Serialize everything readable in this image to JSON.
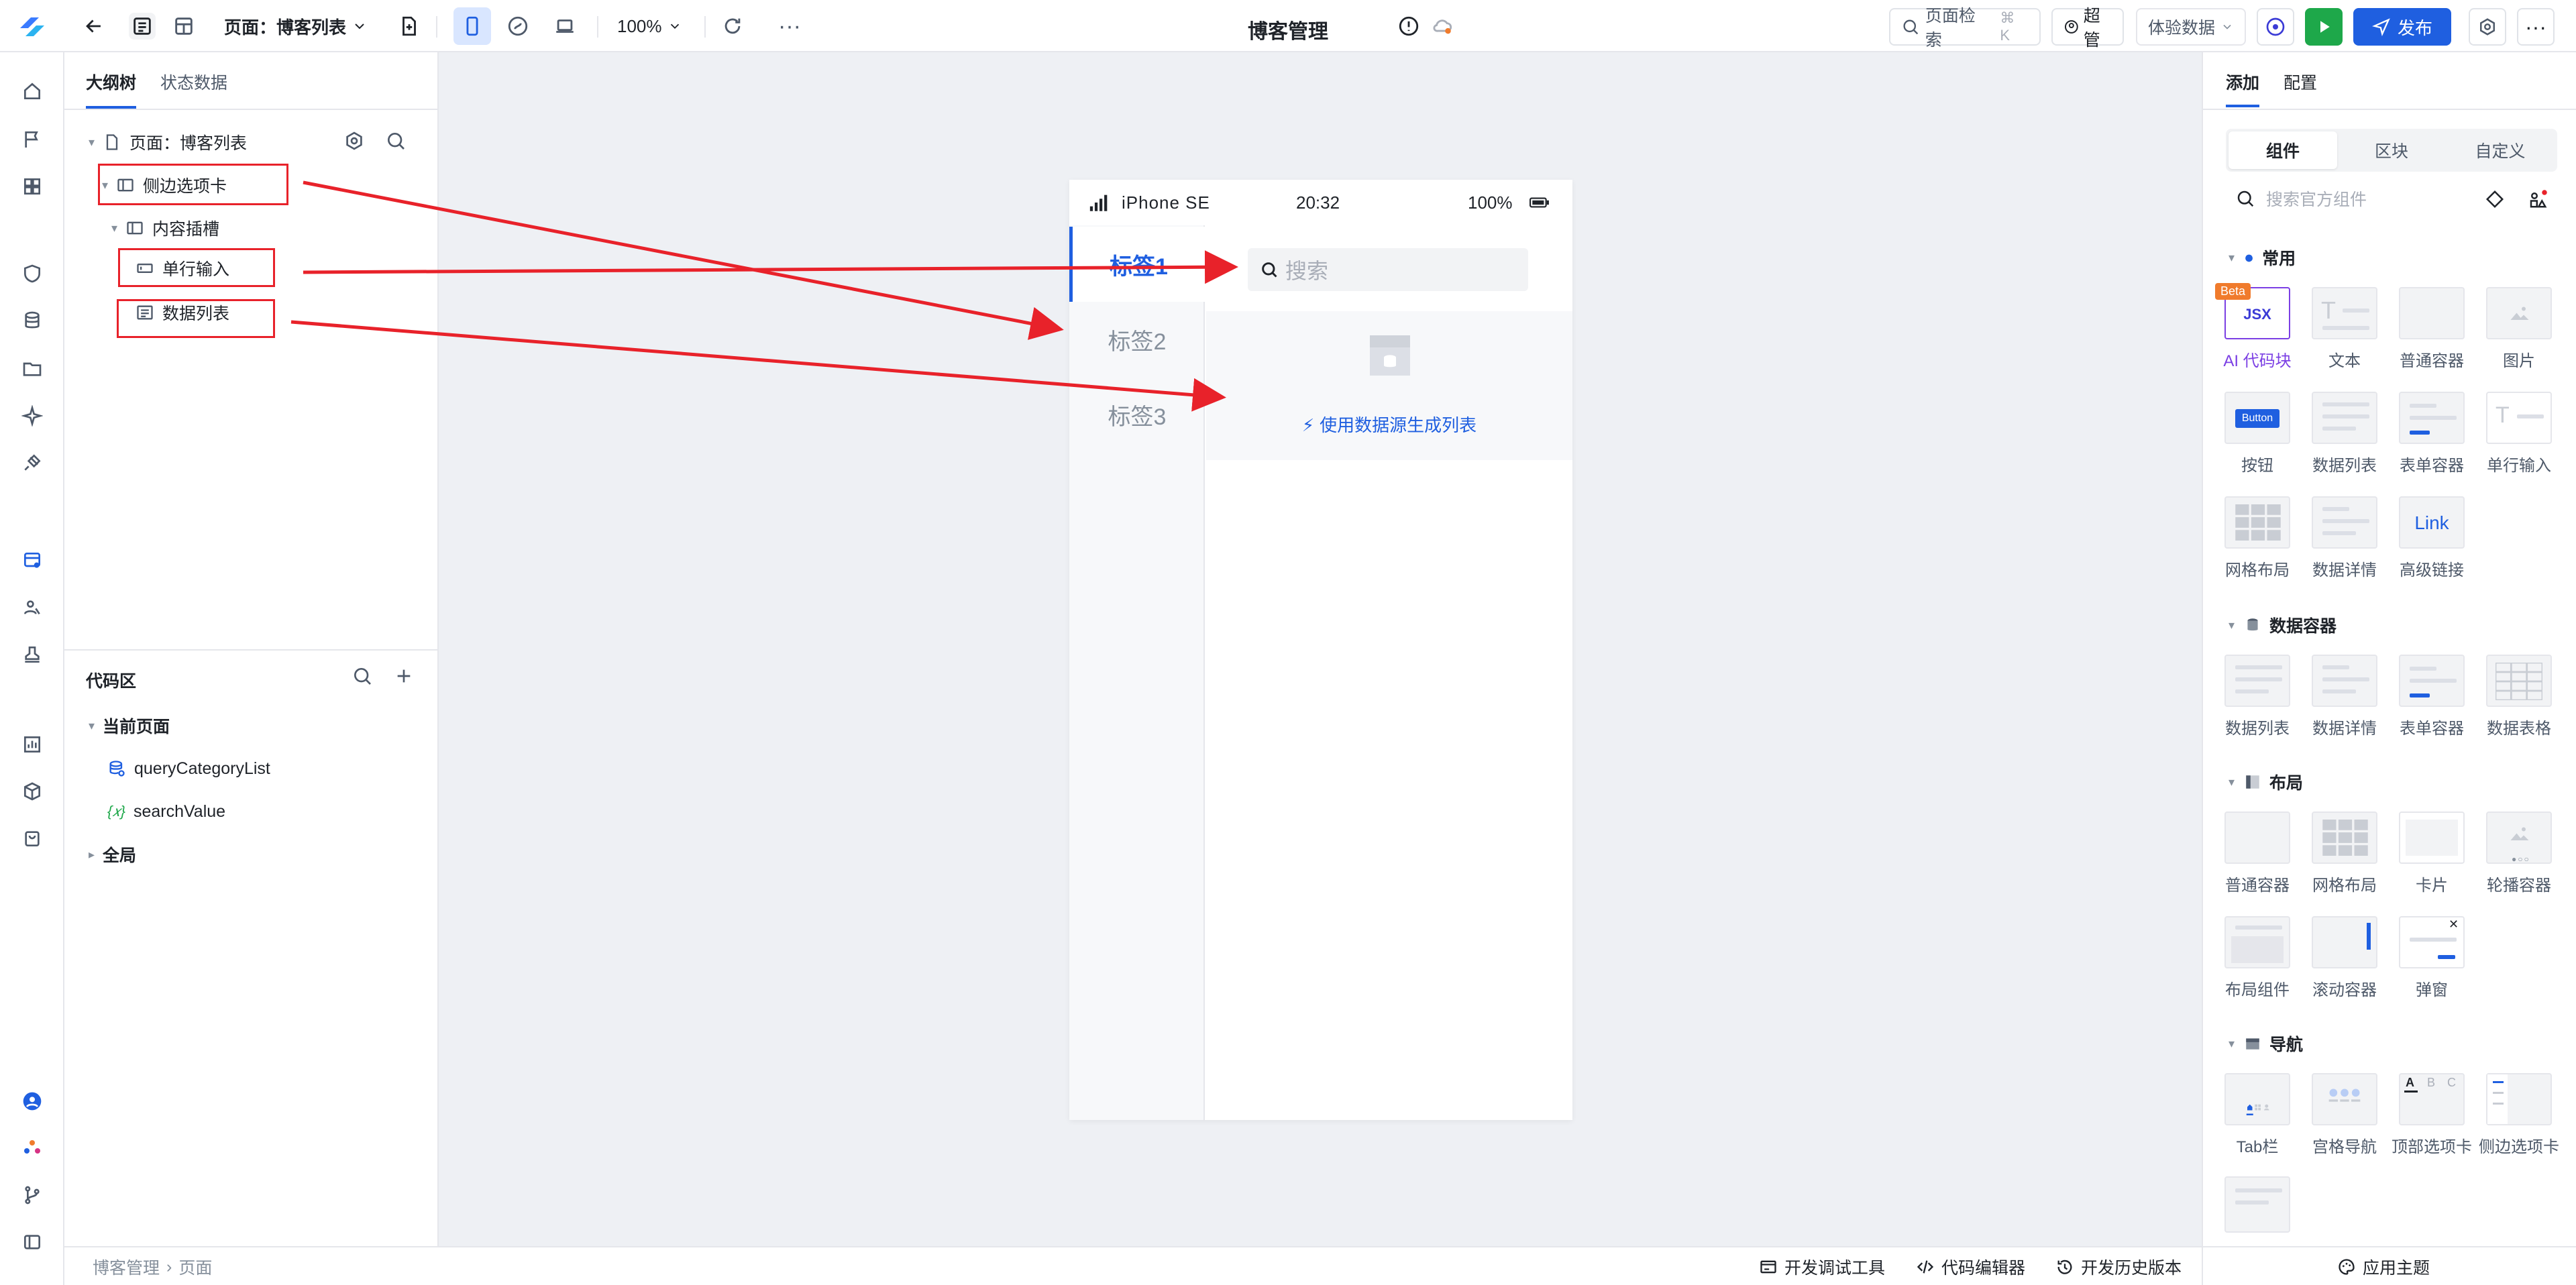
{
  "topbar": {
    "page_label": "页面：博客列表",
    "zoom": "100%",
    "app_title": "博客管理",
    "search_label": "页面检索",
    "search_shortcut": "⌘ K",
    "user_label": "超管",
    "experience_data": "体验数据",
    "publish_label": "发布"
  },
  "outline": {
    "tabs": [
      "大纲树",
      "状态数据"
    ],
    "tree": {
      "page": "页面：博客列表",
      "side_tabs": "侧边选项卡",
      "content_slot": "内容插槽",
      "single_input": "单行输入",
      "data_list": "数据列表"
    },
    "code": {
      "title": "代码区",
      "current_page": "当前页面",
      "items": [
        "queryCategoryList",
        "searchValue"
      ],
      "global": "全局"
    }
  },
  "phone": {
    "device": "iPhone SE",
    "time": "20:32",
    "battery": "100%",
    "tabs": [
      "标签1",
      "标签2",
      "标签3"
    ],
    "search_placeholder": "搜索",
    "gen_list_link": "使用数据源生成列表"
  },
  "right": {
    "tabs": [
      "添加",
      "配置"
    ],
    "segments": [
      "组件",
      "区块",
      "自定义"
    ],
    "search_placeholder": "搜索官方组件",
    "sections": {
      "common": {
        "title": "常用",
        "items": [
          "AI 代码块",
          "文本",
          "普通容器",
          "图片",
          "按钮",
          "数据列表",
          "表单容器",
          "单行输入",
          "网格布局",
          "数据详情",
          "高级链接"
        ]
      },
      "data_container": {
        "title": "数据容器",
        "items": [
          "数据列表",
          "数据详情",
          "表单容器",
          "数据表格"
        ]
      },
      "layout": {
        "title": "布局",
        "items": [
          "普通容器",
          "网格布局",
          "卡片",
          "轮播容器",
          "布局组件",
          "滚动容器",
          "弹窗"
        ]
      },
      "nav": {
        "title": "导航",
        "items": [
          "Tab栏",
          "宫格导航",
          "顶部选项卡",
          "侧边选项卡"
        ]
      }
    },
    "beta_badge": "Beta",
    "jsx_label": "JSX",
    "button_thumb": "Button",
    "link_thumb": "Link",
    "tab_thumb_letters": [
      "A",
      "B",
      "C"
    ]
  },
  "bottombar": {
    "breadcrumb": [
      "博客管理",
      "页面"
    ],
    "dev_tools": "开发调试工具",
    "code_editor": "代码编辑器",
    "history": "开发历史版本",
    "theme": "应用主题"
  },
  "colors": {
    "accent": "#1f5fe0",
    "annotation_red": "#e8222a",
    "run_green": "#1ea84a",
    "ai_purple": "#7b3fe4"
  }
}
